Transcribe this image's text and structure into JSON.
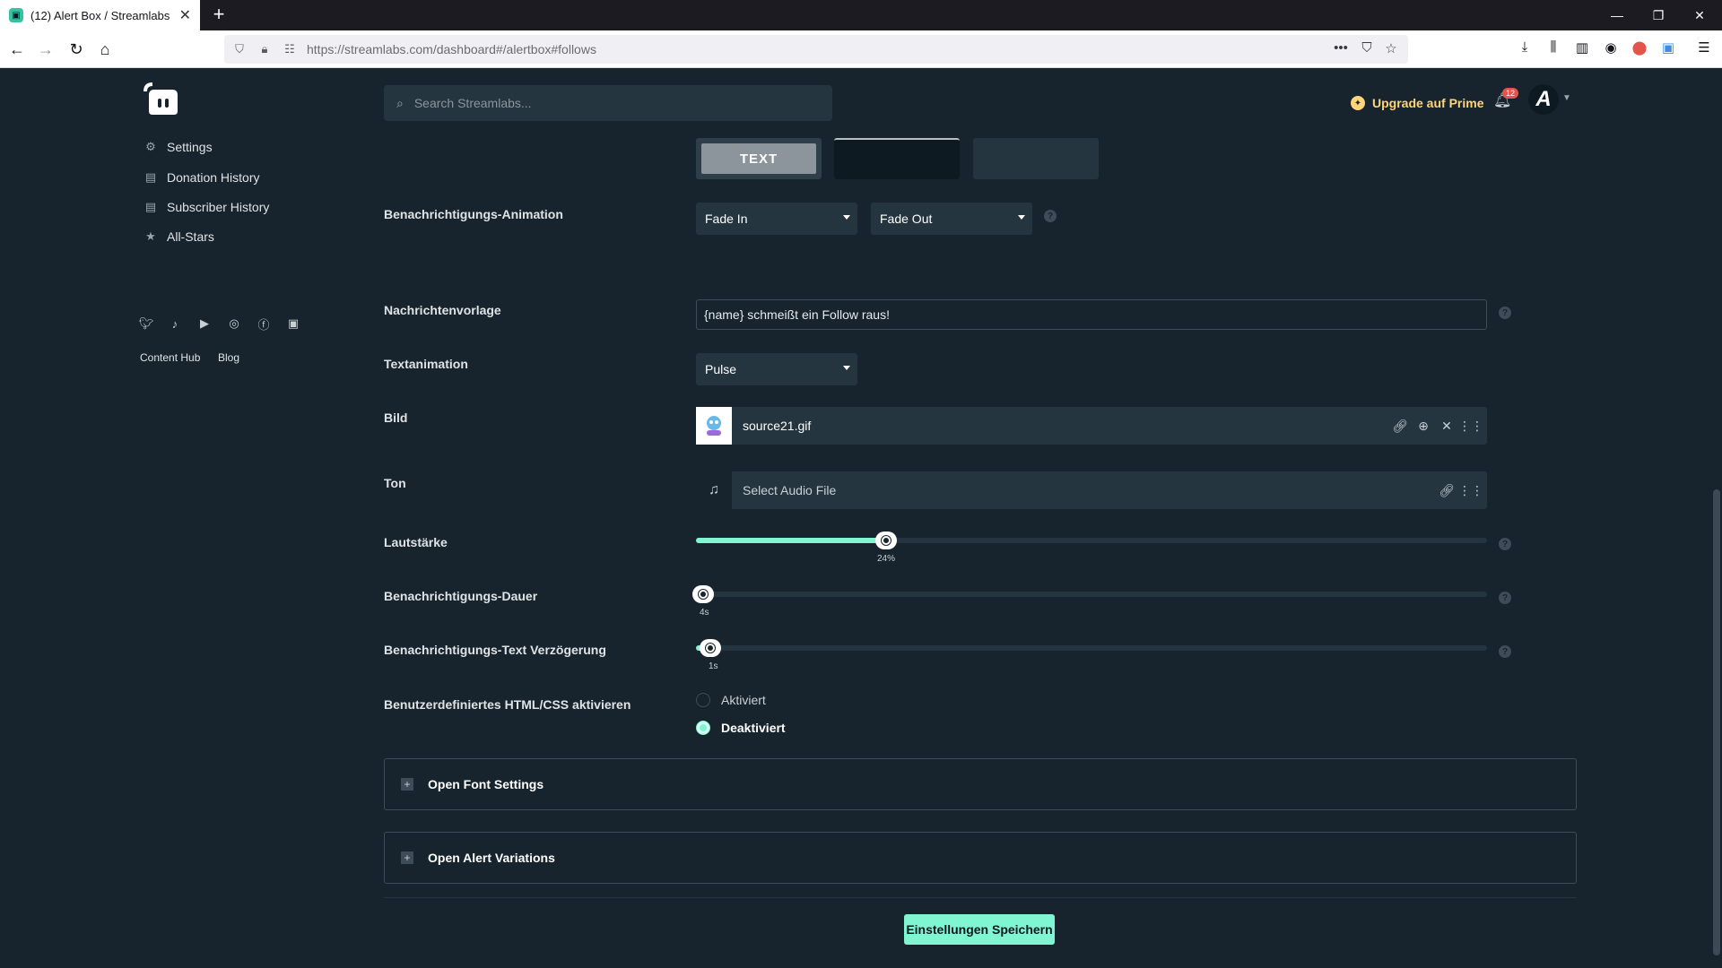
{
  "browser": {
    "tab_title": "(12) Alert Box / Streamlabs",
    "url_host": "https://streamlabs.com",
    "url_path": "/dashboard#/alertbox#follows"
  },
  "sidebar": {
    "items": [
      {
        "label": "Settings",
        "icon": "gear-icon"
      },
      {
        "label": "Donation History",
        "icon": "list-icon"
      },
      {
        "label": "Subscriber History",
        "icon": "list-icon"
      },
      {
        "label": "All-Stars",
        "icon": "star-icon"
      }
    ],
    "social_icons": [
      "twitter-icon",
      "tiktok-icon",
      "youtube-icon",
      "instagram-icon",
      "facebook-icon",
      "discord-icon"
    ],
    "footer_links": [
      "Content Hub",
      "Blog"
    ]
  },
  "header": {
    "search_placeholder": "Search Streamlabs...",
    "upgrade_label": "Upgrade auf Prime",
    "notification_count": "12"
  },
  "colors": {
    "background": "#17242d",
    "panel": "#253540",
    "accent": "#80f5d2",
    "prime": "#ffd47a"
  },
  "form": {
    "text_swatch_label": "TEXT",
    "animation": {
      "label": "Benachrichtigungs-Animation",
      "in_value": "Fade In",
      "out_value": "Fade Out"
    },
    "template": {
      "label": "Nachrichtenvorlage",
      "value": "{name} schmeißt ein Follow raus!"
    },
    "text_animation": {
      "label": "Textanimation",
      "value": "Pulse"
    },
    "image": {
      "label": "Bild",
      "file": "source21.gif"
    },
    "sound": {
      "label": "Ton",
      "placeholder": "Select Audio File"
    },
    "volume": {
      "label": "Lautstärke",
      "value": 24,
      "display": "24%"
    },
    "duration": {
      "label": "Benachrichtigungs-Dauer",
      "value": 4,
      "display": "4s"
    },
    "text_delay": {
      "label": "Benachrichtigungs-Text Verzögerung",
      "value": 1,
      "display": "1s"
    },
    "custom_html": {
      "label": "Benutzerdefiniertes HTML/CSS aktivieren",
      "option_on": "Aktiviert",
      "option_off": "Deaktiviert",
      "selected": "Deaktiviert"
    },
    "font_settings_label": "Open Font Settings",
    "alert_variations_label": "Open Alert Variations",
    "save_label": "Einstellungen Speichern"
  }
}
